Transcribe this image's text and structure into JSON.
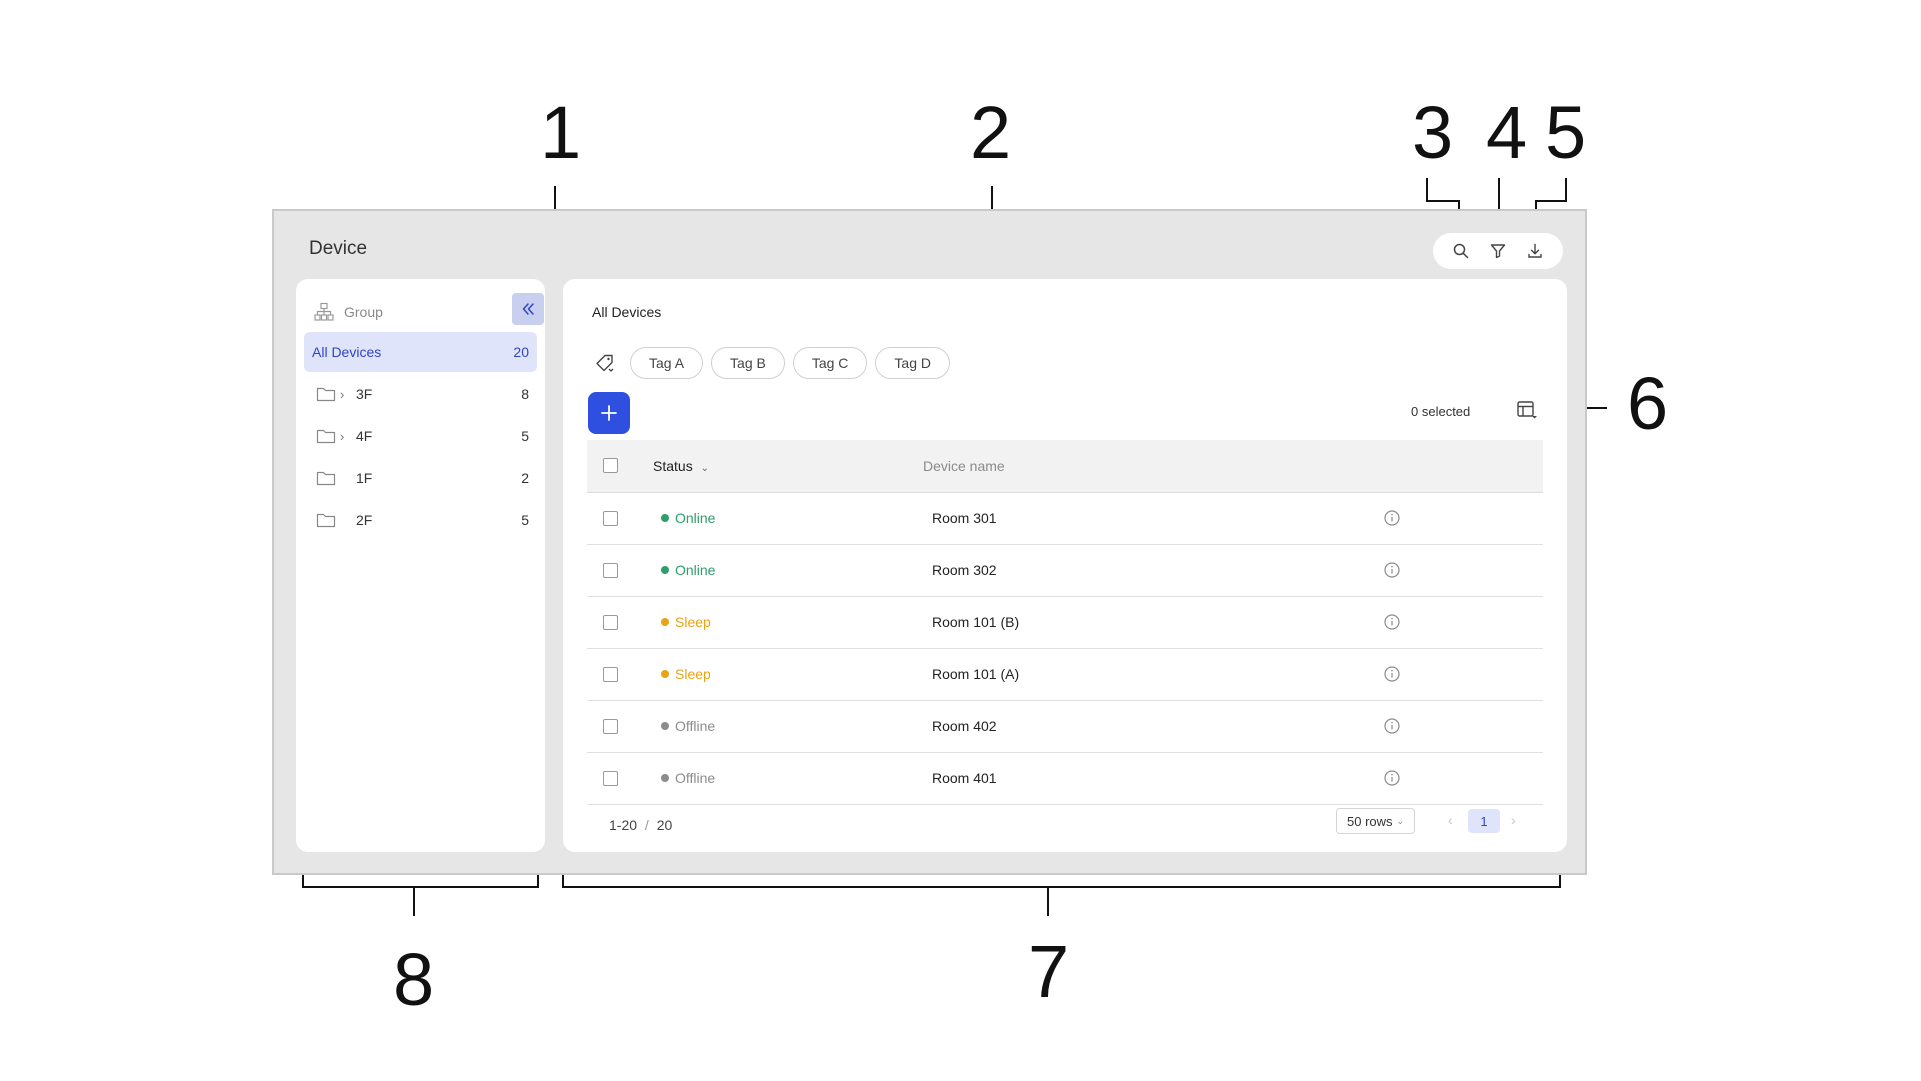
{
  "callouts": [
    "1",
    "2",
    "3",
    "4",
    "5",
    "6",
    "7",
    "8"
  ],
  "window": {
    "title": "Device"
  },
  "toolbar": {
    "icons": [
      "search-icon",
      "filter-icon",
      "download-icon"
    ]
  },
  "sidebar": {
    "header_label": "Group",
    "items": [
      {
        "label": "All Devices",
        "count": "20",
        "active": true
      },
      {
        "label": "3F",
        "count": "8",
        "expandable": true
      },
      {
        "label": "4F",
        "count": "5",
        "expandable": true
      },
      {
        "label": "1F",
        "count": "2",
        "expandable": false
      },
      {
        "label": "2F",
        "count": "5",
        "expandable": false
      }
    ]
  },
  "main": {
    "title": "All Devices",
    "tags": [
      "Tag A",
      "Tag B",
      "Tag C",
      "Tag D"
    ],
    "selected_text": "0 selected",
    "columns": {
      "status": "Status",
      "name": "Device name"
    },
    "rows": [
      {
        "status": "Online",
        "name": "Room 301"
      },
      {
        "status": "Online",
        "name": "Room 302"
      },
      {
        "status": "Sleep",
        "name": "Room 101 (B)"
      },
      {
        "status": "Sleep",
        "name": "Room 101 (A)"
      },
      {
        "status": "Offline",
        "name": "Room 402"
      },
      {
        "status": "Offline",
        "name": "Room 401"
      }
    ],
    "footer": {
      "range": "1-20",
      "separator": "/",
      "total": "20",
      "rows_per_page": "50 rows",
      "current_page": "1"
    }
  },
  "colors": {
    "accent": "#2f4fe0",
    "online": "#2e9e6a",
    "sleep": "#e8a317",
    "offline": "#8c8c8c"
  }
}
